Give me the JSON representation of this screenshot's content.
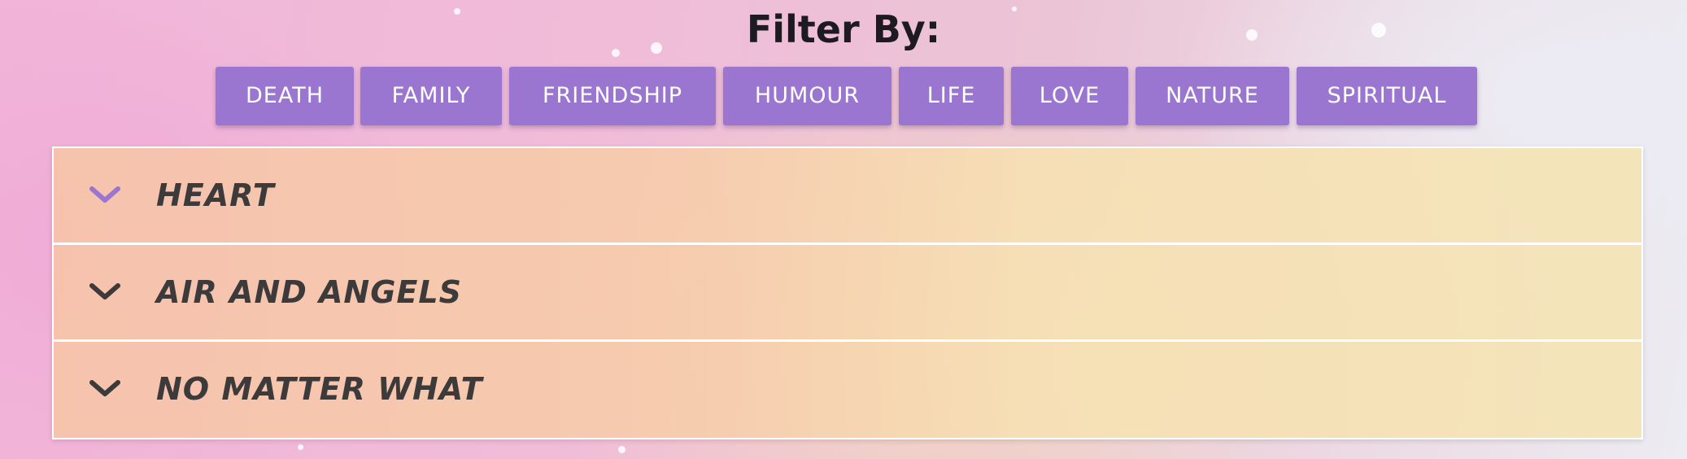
{
  "filter": {
    "title": "Filter By:",
    "buttons": [
      {
        "label": "DEATH"
      },
      {
        "label": "FAMILY"
      },
      {
        "label": "FRIENDSHIP"
      },
      {
        "label": "HUMOUR"
      },
      {
        "label": "LIFE"
      },
      {
        "label": "LOVE"
      },
      {
        "label": "NATURE"
      },
      {
        "label": "SPIRITUAL"
      }
    ]
  },
  "poems": [
    {
      "title": "HEART",
      "icon": "chevron-down-icon",
      "active": true
    },
    {
      "title": "AIR AND ANGELS",
      "icon": "chevron-down-icon",
      "active": false
    },
    {
      "title": "NO MATTER WHAT",
      "icon": "chevron-down-icon",
      "active": false
    }
  ],
  "colors": {
    "button_bg": "#9a76d0",
    "button_text": "#ffffff",
    "active_chevron": "#9a76d0",
    "inactive_chevron": "#3c3a3a",
    "title_text": "#3c3a3a"
  }
}
